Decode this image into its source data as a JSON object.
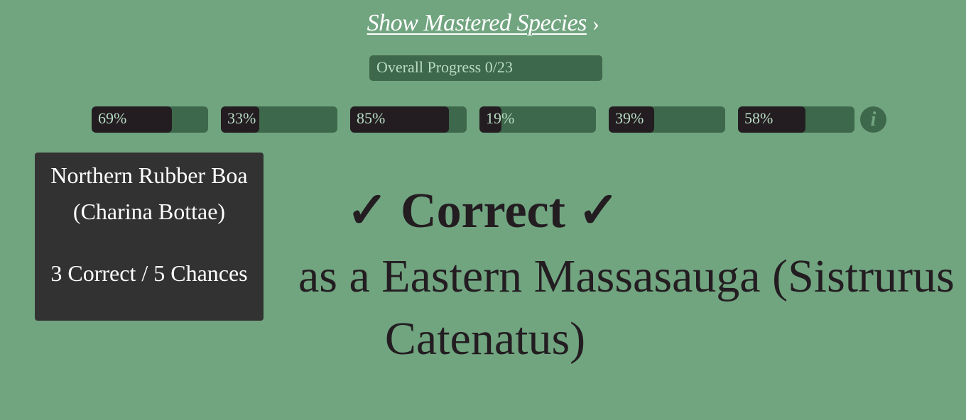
{
  "header": {
    "show_mastered_label": "Show Mastered Species",
    "chevron": "›"
  },
  "overall_progress": {
    "label": "Overall Progress 0/23"
  },
  "species_bars": [
    {
      "label": "69%",
      "percent": 69
    },
    {
      "label": "33%",
      "percent": 33
    },
    {
      "label": "85%",
      "percent": 85
    },
    {
      "label": "19%",
      "percent": 19
    },
    {
      "label": "39%",
      "percent": 39
    },
    {
      "label": "58%",
      "percent": 58
    }
  ],
  "info_button": {
    "glyph": "i",
    "icon": "info-icon"
  },
  "result": {
    "headline": "✓ Correct ✓",
    "answer_line1": "as a Eastern Massasauga (Sistrurus",
    "answer_line2": "Catenatus)"
  },
  "tooltip": {
    "name_line1": "Northern Rubber Boa",
    "name_line2": "(Charina Bottae)",
    "stats": "3 Correct / 5 Chances"
  },
  "colors": {
    "background": "#71a580",
    "bar_track": "#3e684b",
    "bar_fill": "#231d21",
    "tooltip_bg": "#333233",
    "text_dark": "#231d21"
  }
}
